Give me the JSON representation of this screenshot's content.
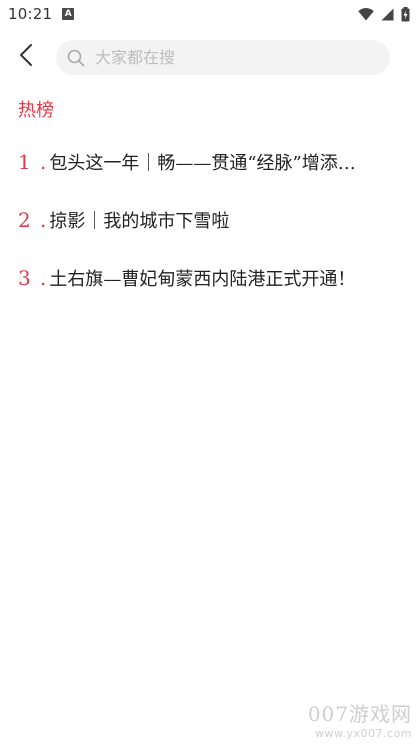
{
  "status_bar": {
    "time": "10:21",
    "notification_badge": "A",
    "icons": [
      "wifi-icon",
      "cell-signal-icon",
      "battery-charging-icon"
    ]
  },
  "header": {
    "back_icon": "chevron-left-icon",
    "search": {
      "placeholder": "大家都在搜",
      "value": ""
    }
  },
  "hot_section": {
    "title": "热榜",
    "items": [
      {
        "rank": "1",
        "dot": ".",
        "text": "包头这一年｜畅——贯通“经脉”增添…"
      },
      {
        "rank": "2",
        "dot": ".",
        "text": "掠影｜我的城市下雪啦"
      },
      {
        "rank": "3",
        "dot": ".",
        "text": "土右旗—曹妃甸蒙西内陆港正式开通！"
      }
    ]
  },
  "watermark": {
    "main": "007游戏网",
    "sub": "www.yx007.com"
  },
  "colors": {
    "accent": "#e53946",
    "search_bg": "#f3f3f3",
    "placeholder": "#bdbdbd"
  }
}
